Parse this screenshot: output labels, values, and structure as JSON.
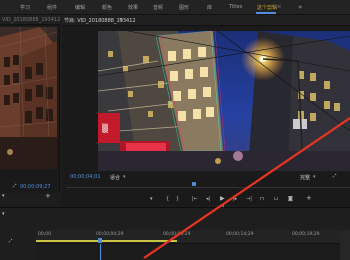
{
  "workspaces": {
    "items": [
      "学习",
      "组件",
      "编辑",
      "颜色",
      "效果",
      "音频",
      "图形",
      "库",
      "Titles",
      "这个剪辑"
    ],
    "active_index": 9,
    "more": "»"
  },
  "source_monitor": {
    "tab_label": "VID_20180888_193412",
    "timecode": "00;00;09;27",
    "buttons": [
      "wrench-icon",
      "add-icon"
    ]
  },
  "program_monitor": {
    "tab_label": "节目: VID_20180888_193412",
    "timecode": "00;00;04;01",
    "fit_label": "适合",
    "quality_label": "完整",
    "wrench": "wrench-icon",
    "transport": [
      "marker",
      "in",
      "out",
      "go-to-in",
      "step-back",
      "play",
      "step-forward",
      "go-to-out",
      "insert",
      "overwrite",
      "export-frame",
      "button-editor"
    ],
    "playhead_fraction": 0.45
  },
  "timeline": {
    "ruler_labels": [
      "00;00",
      "00;00;04;29",
      "00;00;09;29",
      "00;00;14;29",
      "00;00;19;29"
    ],
    "work_area_fraction": 0.45
  },
  "colors": {
    "accent": "#4f8fdc",
    "active_workspace": "#d4a93a",
    "timecode": "#4f8fdc",
    "annotation_arrow": "#e83522",
    "work_area_bar": "#c9c542"
  }
}
